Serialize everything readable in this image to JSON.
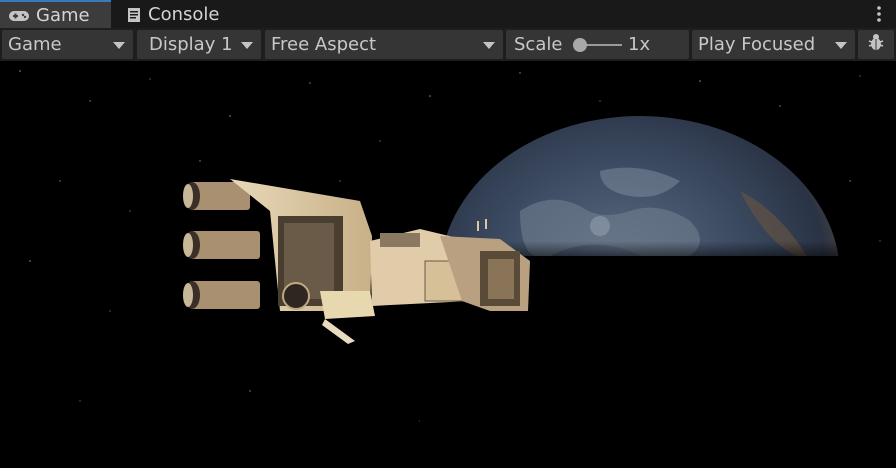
{
  "tabs": [
    {
      "label": "Game",
      "icon": "gamepad-icon",
      "active": true
    },
    {
      "label": "Console",
      "icon": "console-icon",
      "active": false
    }
  ],
  "toolbar": {
    "view_mode": "Game",
    "display": "Display 1",
    "aspect": "Free Aspect",
    "scale_label": "Scale",
    "scale_value": "1x",
    "play_mode": "Play Focused"
  },
  "colors": {
    "accent": "#3a79bb",
    "toolbar_bg": "#1e1e1e",
    "control_bg": "#353535",
    "viewport_bg": "#000000"
  },
  "scene": {
    "objects": [
      "starfield",
      "earth-planet",
      "spaceship"
    ]
  }
}
